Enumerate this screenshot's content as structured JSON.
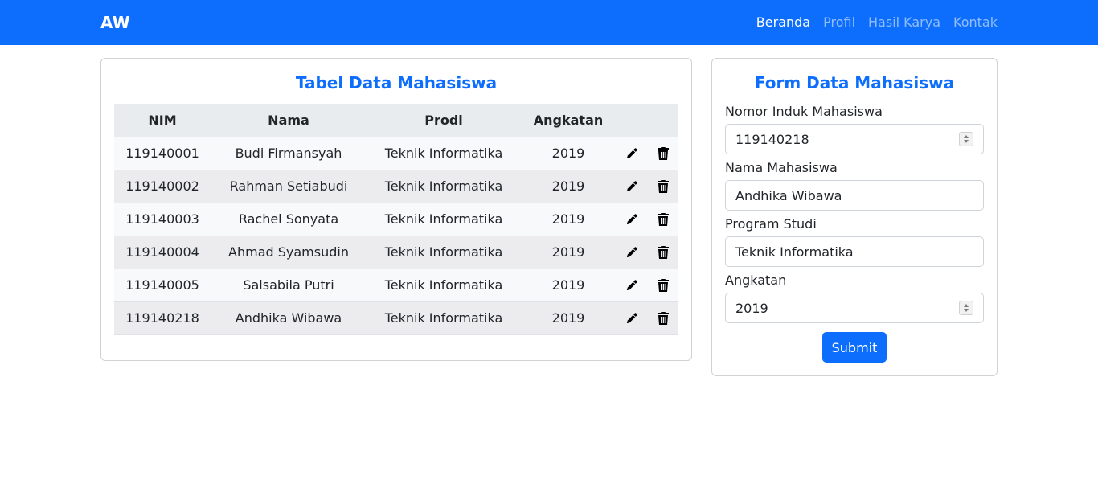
{
  "navbar": {
    "brand": "AW",
    "links": [
      "Beranda",
      "Profil",
      "Hasil Karya",
      "Kontak"
    ],
    "active": "Beranda",
    "color": "#0d6efd"
  },
  "table_card": {
    "title": "Tabel Data Mahasiswa",
    "columns": [
      "NIM",
      "Nama",
      "Prodi",
      "Angkatan"
    ],
    "rows": [
      {
        "nim": "119140001",
        "nama": "Budi Firmansyah",
        "prodi": "Teknik Informatika",
        "angkatan": "2019"
      },
      {
        "nim": "119140002",
        "nama": "Rahman Setiabudi",
        "prodi": "Teknik Informatika",
        "angkatan": "2019"
      },
      {
        "nim": "119140003",
        "nama": "Rachel Sonyata",
        "prodi": "Teknik Informatika",
        "angkatan": "2019"
      },
      {
        "nim": "119140004",
        "nama": "Ahmad Syamsudin",
        "prodi": "Teknik Informatika",
        "angkatan": "2019"
      },
      {
        "nim": "119140005",
        "nama": "Salsabila Putri",
        "prodi": "Teknik Informatika",
        "angkatan": "2019"
      },
      {
        "nim": "119140218",
        "nama": "Andhika Wibawa",
        "prodi": "Teknik Informatika",
        "angkatan": "2019"
      }
    ],
    "row_actions": [
      "pencil-icon",
      "trash-icon"
    ]
  },
  "form_card": {
    "title": "Form Data Mahasiswa",
    "fields": {
      "nim": {
        "label": "Nomor Induk Mahasiswa",
        "value": "119140218"
      },
      "nama": {
        "label": "Nama Mahasiswa",
        "value": "Andhika Wibawa"
      },
      "prodi": {
        "label": "Program Studi",
        "value": "Teknik Informatika"
      },
      "angkatan": {
        "label": "Angkatan",
        "value": "2019"
      }
    },
    "submit_label": "Submit"
  }
}
